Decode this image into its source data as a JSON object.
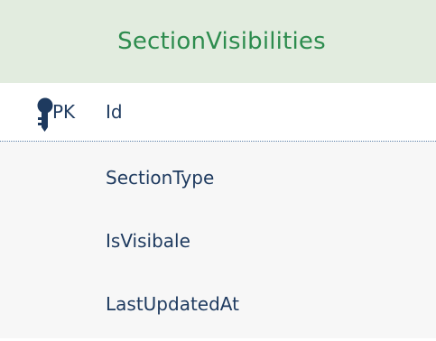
{
  "entity": {
    "title": "SectionVisibilities",
    "primary_key": {
      "badge": "PK",
      "name": "Id",
      "icon": "key-icon"
    },
    "fields": [
      "SectionType",
      "IsVisibale",
      "LastUpdatedAt"
    ]
  },
  "colors": {
    "header_bg": "#e2ecdf",
    "title": "#2d8c4e",
    "body_bg": "#f7f7f7",
    "text": "#1e3a5f",
    "key": "#1e3a5f",
    "divider": "#5b7fa6"
  }
}
